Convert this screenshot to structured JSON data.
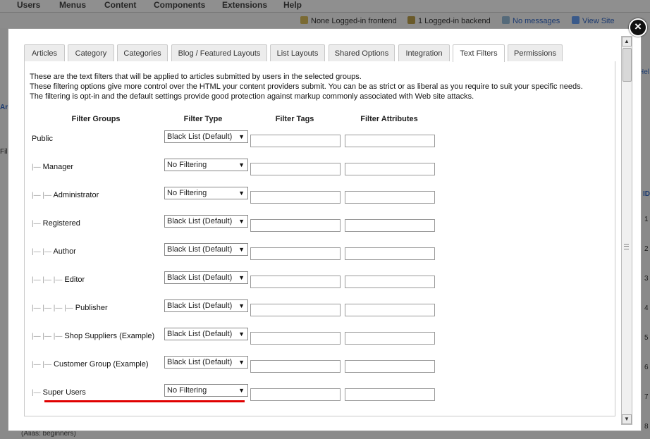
{
  "background": {
    "menu": [
      "Users",
      "Menus",
      "Content",
      "Components",
      "Extensions",
      "Help"
    ],
    "status": {
      "frontend": "None Logged-in frontend",
      "backend": "1 Logged-in backend",
      "messages": "No messages",
      "view_site": "View Site"
    },
    "side_fragments": [
      "Ar",
      "Fil",
      "Hel",
      "ID",
      "1",
      "2",
      "3",
      "4",
      "5",
      "6",
      "7",
      "8"
    ],
    "bottom_text": "(Alias: beginners)"
  },
  "modal": {
    "close_symbol": "×",
    "tabs": [
      {
        "label": "Articles"
      },
      {
        "label": "Category"
      },
      {
        "label": "Categories"
      },
      {
        "label": "Blog / Featured Layouts"
      },
      {
        "label": "List Layouts"
      },
      {
        "label": "Shared Options"
      },
      {
        "label": "Integration"
      },
      {
        "label": "Text Filters",
        "active": true
      },
      {
        "label": "Permissions"
      }
    ],
    "description": [
      "These are the text filters that will be applied to articles submitted by users in the selected groups.",
      "These filtering options give more control over the HTML your content providers submit. You can be as strict or as liberal as you require to suit your specific needs. The filtering is opt-in and the default settings provide good protection against markup commonly associated with Web site attacks."
    ],
    "columns": {
      "groups": "Filter Groups",
      "type": "Filter Type",
      "tags": "Filter Tags",
      "attributes": "Filter Attributes"
    },
    "rows": [
      {
        "tree": "",
        "group": "Public",
        "filter": "Black List (Default)",
        "tags": "",
        "attributes": ""
      },
      {
        "tree": "|—",
        "group": "Manager",
        "filter": "No Filtering",
        "tags": "",
        "attributes": ""
      },
      {
        "tree": "|— |—",
        "group": "Administrator",
        "filter": "No Filtering",
        "tags": "",
        "attributes": ""
      },
      {
        "tree": "|—",
        "group": "Registered",
        "filter": "Black List (Default)",
        "tags": "",
        "attributes": ""
      },
      {
        "tree": "|— |—",
        "group": "Author",
        "filter": "Black List (Default)",
        "tags": "",
        "attributes": ""
      },
      {
        "tree": "|— |— |—",
        "group": "Editor",
        "filter": "Black List (Default)",
        "tags": "",
        "attributes": ""
      },
      {
        "tree": "|— |— |— |—",
        "group": "Publisher",
        "filter": "Black List (Default)",
        "tags": "",
        "attributes": ""
      },
      {
        "tree": "|— |— |—",
        "group": "Shop Suppliers (Example)",
        "filter": "Black List (Default)",
        "tags": "",
        "attributes": ""
      },
      {
        "tree": "|— |—",
        "group": "Customer Group (Example)",
        "filter": "Black List (Default)",
        "tags": "",
        "attributes": ""
      },
      {
        "tree": "|—",
        "group": "Super Users",
        "filter": "No Filtering",
        "tags": "",
        "attributes": ""
      }
    ],
    "highlight_color": "#e00000",
    "select_arrow": "▼"
  }
}
